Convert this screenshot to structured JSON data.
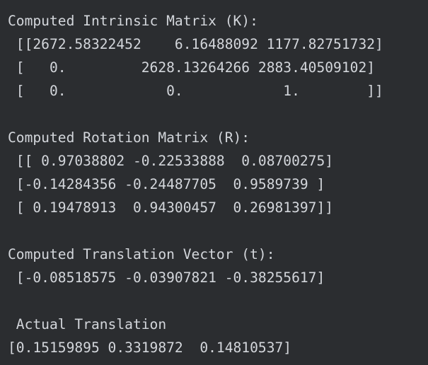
{
  "console": {
    "lines": [
      "Computed Intrinsic Matrix (K):",
      " [[2672.58322452    6.16488092 1177.82751732]",
      " [   0.         2628.13264266 2883.40509102]",
      " [   0.            0.            1.        ]]",
      "",
      "Computed Rotation Matrix (R):",
      " [[ 0.97038802 -0.22533888  0.08700275]",
      " [-0.14284356 -0.24487705  0.9589739 ]",
      " [ 0.19478913  0.94300457  0.26981397]]",
      "",
      "Computed Translation Vector (t):",
      " [-0.08518575 -0.03907821 -0.38255617]",
      "",
      " Actual Translation",
      "[0.15159895 0.3319872  0.14810537]"
    ]
  },
  "colors": {
    "background": "#2b2d30",
    "text": "#d3d6db"
  }
}
